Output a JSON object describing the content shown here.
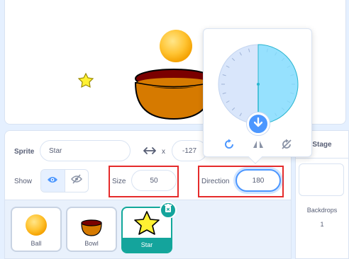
{
  "sprite_info": {
    "sprite_label": "Sprite",
    "sprite_name": "Star",
    "x_label": "x",
    "x_value": "-127",
    "show_label": "Show",
    "size_label": "Size",
    "size_value": "50",
    "direction_label": "Direction",
    "direction_value": "180"
  },
  "sprites": [
    {
      "name": "Ball"
    },
    {
      "name": "Bowl"
    },
    {
      "name": "Star"
    }
  ],
  "stage_panel": {
    "title": "Stage",
    "backdrops_label": "Backdrops",
    "backdrops_count": "1"
  },
  "direction_dial": {
    "value": 180
  },
  "colors": {
    "accent": "#4c97ff",
    "selected_sprite": "#14a49c",
    "highlight": "#e52b2b"
  }
}
